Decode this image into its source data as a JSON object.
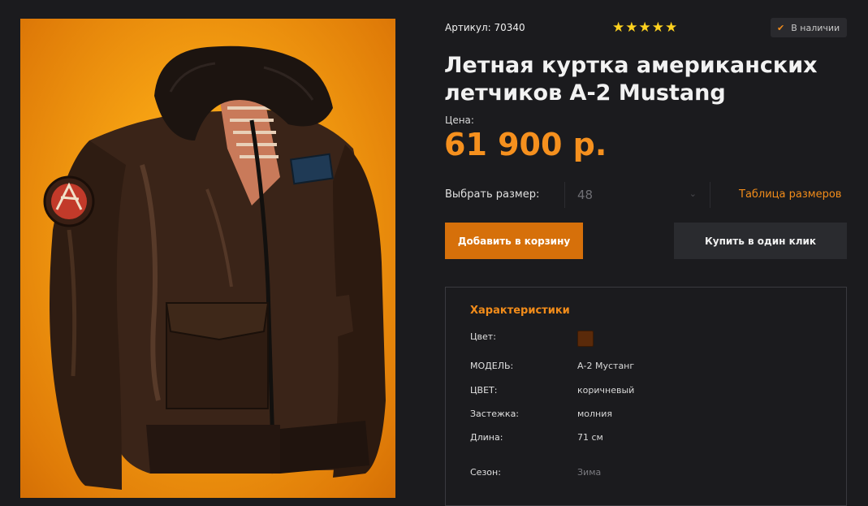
{
  "product": {
    "sku": "Артикул: 70340",
    "rating": 5,
    "stock": "В наличии",
    "title": "Летная куртка американских летчиков А-2 Mustang",
    "price_label": "Цена:",
    "price": "61 900 р."
  },
  "size": {
    "label": "Выбрать размер:",
    "selected": "48",
    "table_link": "Таблица размеров"
  },
  "buttons": {
    "cart": "Добавить в корзину",
    "one_click": "Купить в один клик"
  },
  "specs": {
    "title": "Характеристики",
    "color_label": "Цвет:",
    "swatch_color": "#5a2a0a",
    "rows": [
      {
        "key": "МОДЕЛЬ:",
        "value": "А-2 Мустанг"
      },
      {
        "key": "ЦВЕТ:",
        "value": "коричневый"
      },
      {
        "key": "Застежка:",
        "value": "молния"
      },
      {
        "key": "Длина:",
        "value": "71 см"
      },
      {
        "key": "Сезон:",
        "value": "Зима"
      }
    ]
  },
  "colors": {
    "accent": "#f28c1a",
    "price": "#f5901e",
    "cart_button": "#d6700a",
    "background": "#1b1b1e"
  }
}
